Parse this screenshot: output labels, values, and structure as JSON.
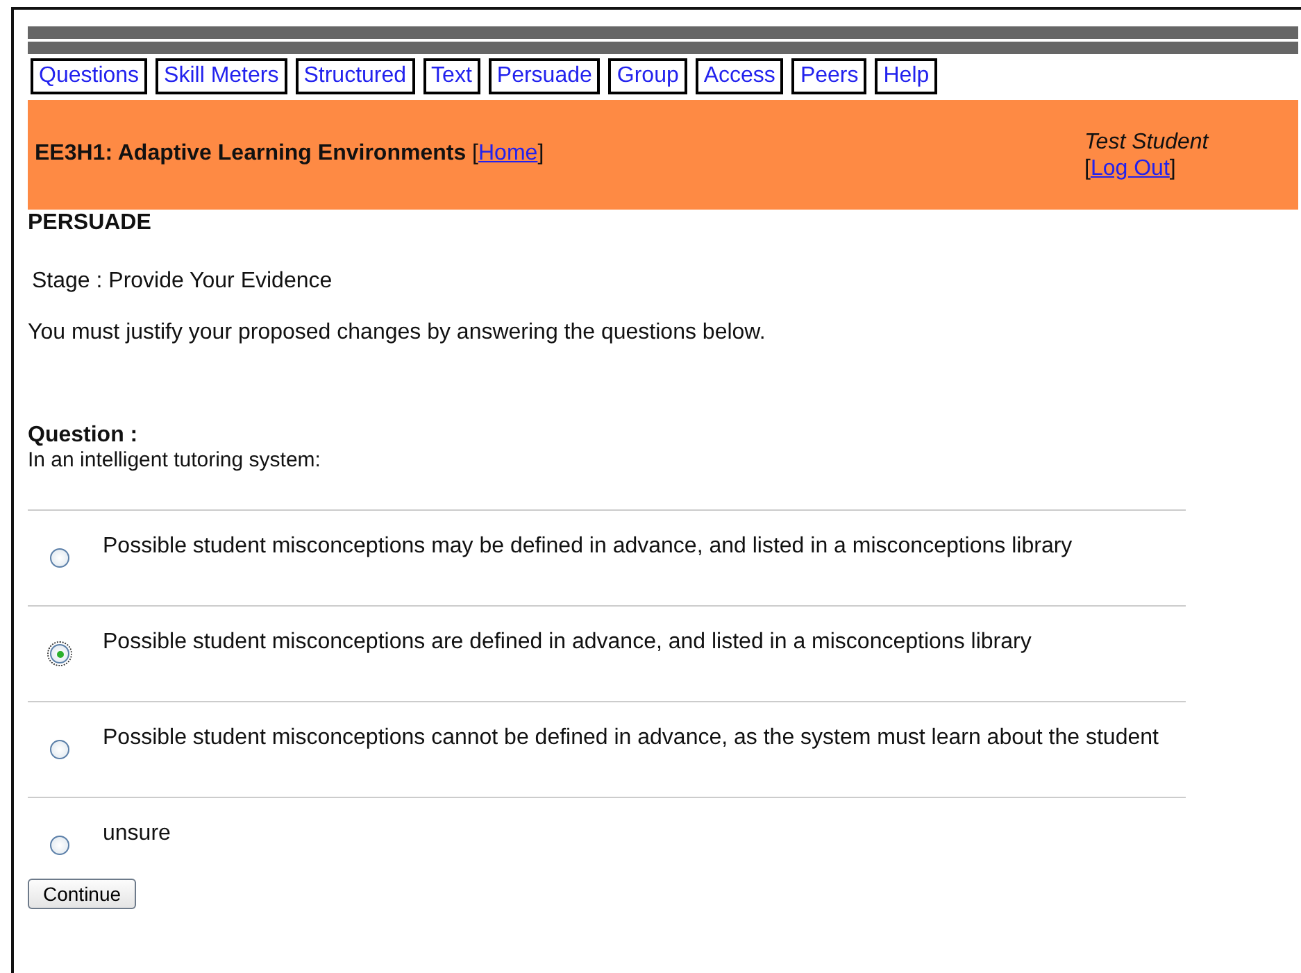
{
  "nav_tabs": [
    {
      "label": "Questions"
    },
    {
      "label": "Skill Meters"
    },
    {
      "label": "Structured"
    },
    {
      "label": "Text"
    },
    {
      "label": "Persuade"
    },
    {
      "label": "Group"
    },
    {
      "label": "Access"
    },
    {
      "label": "Peers"
    },
    {
      "label": "Help"
    }
  ],
  "header": {
    "course": "EE3H1: Adaptive Learning Environments",
    "home_open": "[",
    "home_link": "Home",
    "home_close": "]",
    "user": "Test Student",
    "logout_open": "[",
    "logout_link": "Log Out",
    "logout_close": "]"
  },
  "page_title": "PERSUADE",
  "stage": "Stage : Provide Your Evidence",
  "instruction": "You must justify your proposed changes by answering the questions below.",
  "question": {
    "heading": "Question :",
    "text": "In an intelligent tutoring system:"
  },
  "options": [
    {
      "label": "Possible student misconceptions may be defined in advance, and listed in a misconceptions library",
      "selected": false
    },
    {
      "label": "Possible student misconceptions are defined in advance, and listed in a misconceptions library",
      "selected": true
    },
    {
      "label": "Possible student misconceptions cannot be defined in advance, as the system must learn about the student",
      "selected": false
    },
    {
      "label": "unsure",
      "selected": false
    }
  ],
  "continue_button": "Continue"
}
